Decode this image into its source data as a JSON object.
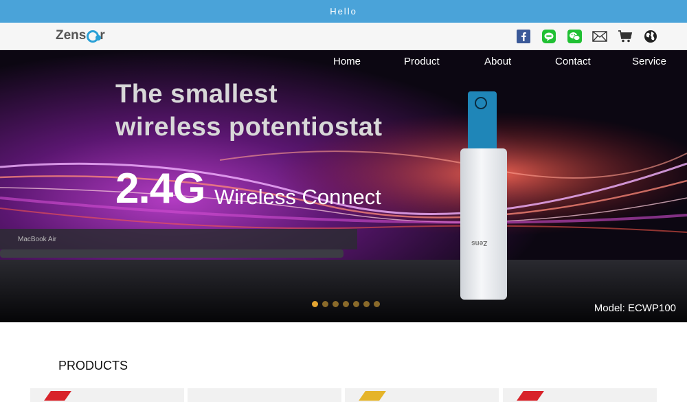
{
  "topbar": {
    "text": "Hello"
  },
  "header": {
    "logo": {
      "pre": "Zens",
      "post": "r"
    },
    "icons": [
      "facebook-icon",
      "line-icon",
      "wechat-icon",
      "mail-icon",
      "cart-icon",
      "globe-icon"
    ]
  },
  "nav": {
    "items": [
      {
        "label": "Home"
      },
      {
        "label": "Product"
      },
      {
        "label": "About"
      },
      {
        "label": "Contact"
      },
      {
        "label": "Service"
      }
    ]
  },
  "banner": {
    "headline_line1": "The smallest",
    "headline_line2": "wireless potentiostat",
    "big_number": "2.4G",
    "connect_text": "Wireless Connect",
    "laptop_label": "MacBook Air",
    "model": "Model: ECWP100",
    "slide_count": 7,
    "active_slide": 1,
    "usb_brand": "Zens",
    "dot_active_color": "#e5a531",
    "dot_inactive_color": "#8a6a2a"
  },
  "products": {
    "title": "PRODUCTS",
    "card_tag_colors": [
      "#d8232a",
      "",
      "#e5b42a",
      "#d8232a"
    ]
  },
  "colors": {
    "topbar": "#4aa3d9",
    "accent_blue": "#2aa0d6"
  }
}
